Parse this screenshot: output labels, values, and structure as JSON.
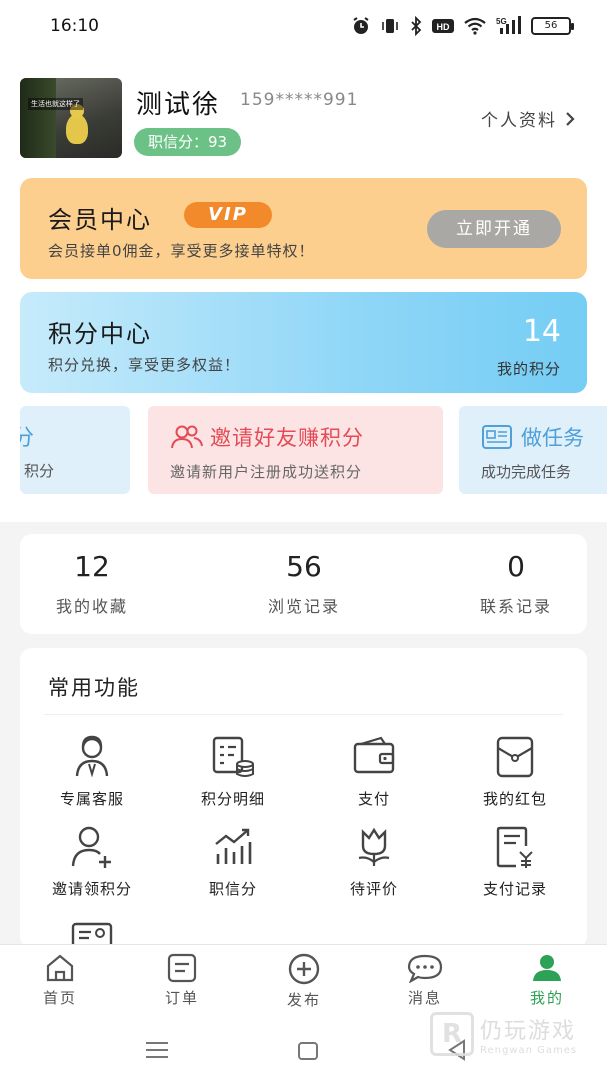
{
  "status_bar": {
    "time": "16:10",
    "network": "5G",
    "hd": "HD",
    "battery": "56",
    "icons": [
      "alarm-icon",
      "vibrate-icon",
      "bluetooth-icon",
      "hd-icon",
      "wifi-icon",
      "signal-icon",
      "battery-icon"
    ]
  },
  "profile": {
    "name": "测试徐",
    "phone": "159*****991",
    "avatar_caption": "生活也就这样了",
    "credit_label": "职信分：93",
    "profile_link": "个人资料"
  },
  "vip": {
    "title": "会员中心",
    "badge": "VIP",
    "description": "会员接单0佣金，享受更多接单特权！",
    "button": "立即开通",
    "colors": {
      "card": "#fccf8f",
      "badge": "#f28a2b"
    }
  },
  "points": {
    "title": "积分中心",
    "description": "积分兑换，享受更多权益！",
    "value": "14",
    "value_label": "我的积分"
  },
  "promos": [
    {
      "title": "分",
      "desc": "积分"
    },
    {
      "title": "邀请好友赚积分",
      "desc": "邀请新用户注册成功送积分",
      "icon": "users-icon"
    },
    {
      "title": "做任务",
      "desc": "成功完成任务",
      "icon": "task-card-icon"
    }
  ],
  "stats": [
    {
      "value": "12",
      "label": "我的收藏"
    },
    {
      "value": "56",
      "label": "浏览记录"
    },
    {
      "value": "0",
      "label": "联系记录"
    }
  ],
  "functions": {
    "title": "常用功能",
    "items": [
      {
        "label": "专属客服",
        "icon": "customer-service-icon"
      },
      {
        "label": "积分明细",
        "icon": "points-detail-icon"
      },
      {
        "label": "支付",
        "icon": "wallet-icon"
      },
      {
        "label": "我的红包",
        "icon": "red-packet-icon"
      },
      {
        "label": "邀请领积分",
        "icon": "add-user-icon"
      },
      {
        "label": "职信分",
        "icon": "chart-icon"
      },
      {
        "label": "待评价",
        "icon": "flower-icon"
      },
      {
        "label": "支付记录",
        "icon": "payment-record-icon"
      }
    ]
  },
  "tabs": [
    {
      "label": "首页",
      "icon": "home-icon"
    },
    {
      "label": "订单",
      "icon": "order-icon"
    },
    {
      "label": "发布",
      "icon": "add-circle-icon"
    },
    {
      "label": "消息",
      "icon": "chat-icon"
    },
    {
      "label": "我的",
      "icon": "user-icon",
      "active": true
    }
  ],
  "watermark": {
    "title": "仍玩游戏",
    "subtitle": "Rengwan Games"
  },
  "colors": {
    "accent": "#2da155",
    "credit": "#6cc286",
    "invite_text": "#e34b56",
    "link_blue": "#4f9fd8"
  }
}
